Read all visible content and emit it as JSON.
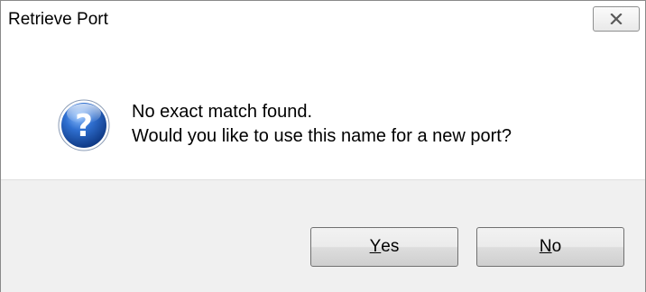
{
  "window": {
    "title": "Retrieve Port",
    "close_icon": "close-x-icon"
  },
  "message": {
    "icon": "question-icon",
    "line1": "No exact match found.",
    "line2": "Would you like to use this name for a new port?"
  },
  "buttons": {
    "yes": {
      "mnemonic": "Y",
      "rest": "es"
    },
    "no": {
      "mnemonic": "N",
      "rest": "o"
    }
  },
  "colors": {
    "icon_blue": "#1f5fb4",
    "footer_bg": "#f0f0f0"
  }
}
